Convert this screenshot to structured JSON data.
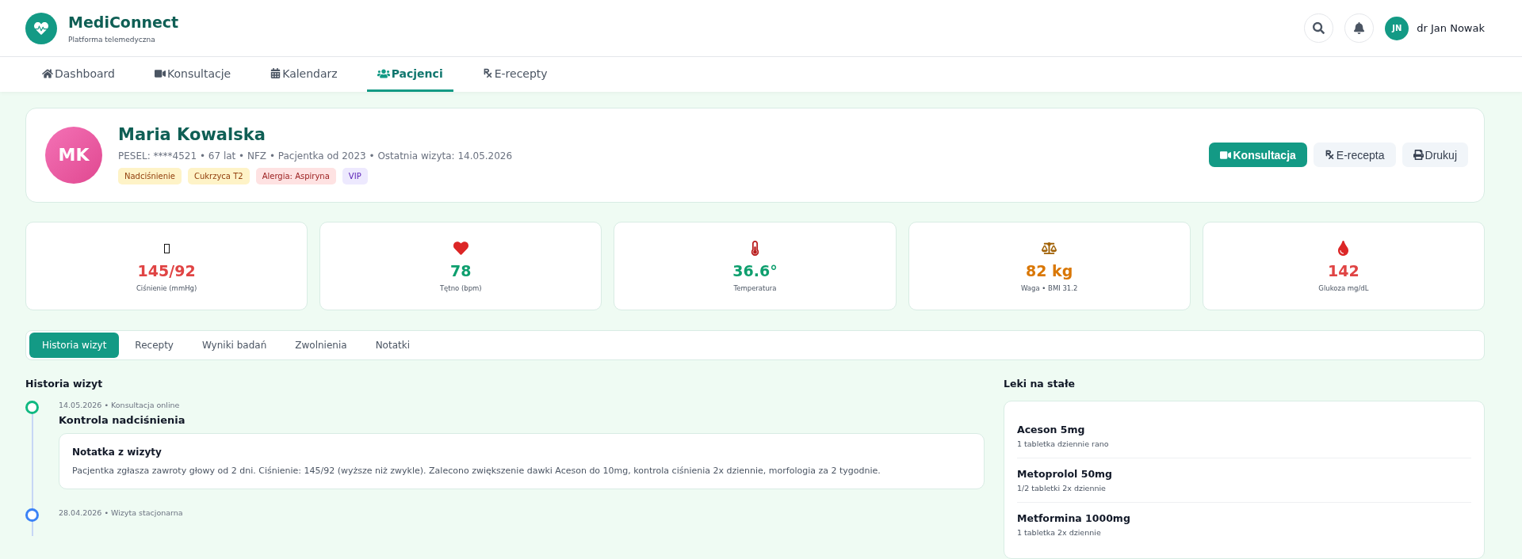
{
  "brand": {
    "name": "MediConnect",
    "tagline": "Platforma telemedyczna"
  },
  "user": {
    "initials": "JN",
    "name": "dr Jan Nowak"
  },
  "nav": [
    {
      "label": "Dashboard",
      "selected": false
    },
    {
      "label": "Konsultacje",
      "selected": false
    },
    {
      "label": "Kalendarz",
      "selected": false
    },
    {
      "label": "Pacjenci",
      "selected": true
    },
    {
      "label": "E-recepty",
      "selected": false
    }
  ],
  "patient": {
    "initials": "MK",
    "name": "Maria Kowalska",
    "meta": "PESEL: ****4521 • 67 lat • NFZ • Pacjentka od 2023 • Ostatnia wizyta: 14.05.2026",
    "tags": [
      {
        "label": "Nadciśnienie",
        "kind": "warning"
      },
      {
        "label": "Cukrzyca T2",
        "kind": "warning"
      },
      {
        "label": "Alergia: Aspiryna",
        "kind": "danger"
      },
      {
        "label": "VIP",
        "kind": "vip"
      }
    ],
    "actions": [
      {
        "label": "Konsultacja",
        "kind": "primary"
      },
      {
        "label": "E-recepta",
        "kind": "secondary"
      },
      {
        "label": "Drukuj",
        "kind": "secondary"
      }
    ]
  },
  "vitals": [
    {
      "value": "145/92",
      "label": "Ciśnienie (mmHg)",
      "color": "#e04444"
    },
    {
      "value": "78",
      "label": "Tętno (bpm)",
      "color": "#0e9f6e"
    },
    {
      "value": "36.6°",
      "label": "Temperatura",
      "color": "#0e9f6e"
    },
    {
      "value": "82 kg",
      "label": "Waga • BMI 31.2",
      "color": "#d97706"
    },
    {
      "value": "142",
      "label": "Glukoza mg/dL",
      "color": "#e04444"
    }
  ],
  "tabs": [
    {
      "label": "Historia wizyt",
      "selected": true
    },
    {
      "label": "Recepty",
      "selected": false
    },
    {
      "label": "Wyniki badań",
      "selected": false
    },
    {
      "label": "Zwolnienia",
      "selected": false
    },
    {
      "label": "Notatki",
      "selected": false
    }
  ],
  "history": {
    "title": "Historia wizyt",
    "items": [
      {
        "meta": "14.05.2026 • Konsultacja online",
        "title": "Kontrola nadciśnienia",
        "color": "#10b981",
        "note": {
          "title": "Notatka z wizyty",
          "text": "Pacjentka zgłasza zawroty głowy od 2 dni. Ciśnienie: 145/92 (wyższe niż zwykle). Zalecono zwiększenie dawki Aceson do 10mg, kontrola ciśnienia 2x dziennie, morfologia za 2 tygodnie."
        }
      },
      {
        "meta": "28.04.2026 • Wizyta stacjonarna",
        "color": "#3b82f6"
      }
    ]
  },
  "medications": {
    "title": "Leki na stałe",
    "items": [
      {
        "name": "Aceson 5mg",
        "dose": "1 tabletka dziennie rano"
      },
      {
        "name": "Metoprolol 50mg",
        "dose": "1/2 tabletki 2x dziennie"
      },
      {
        "name": "Metformina 1000mg",
        "dose": "1 tabletka 2x dziennie"
      }
    ]
  }
}
